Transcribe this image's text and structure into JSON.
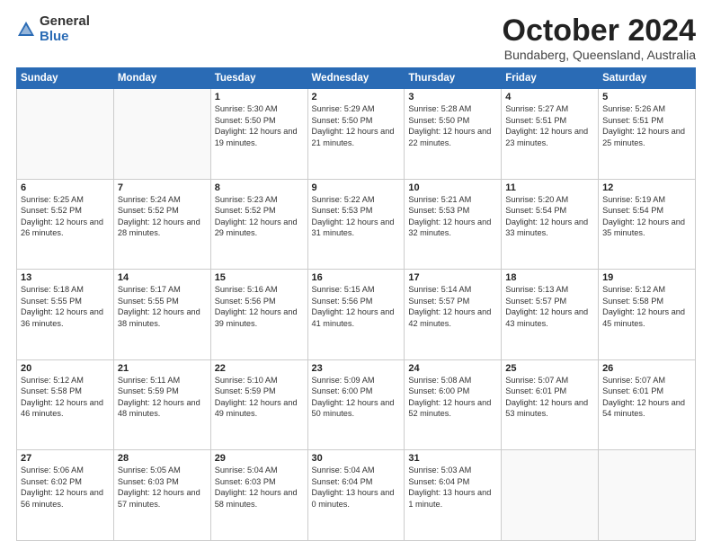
{
  "logo": {
    "general": "General",
    "blue": "Blue"
  },
  "title": {
    "month_year": "October 2024",
    "location": "Bundaberg, Queensland, Australia"
  },
  "days_of_week": [
    "Sunday",
    "Monday",
    "Tuesday",
    "Wednesday",
    "Thursday",
    "Friday",
    "Saturday"
  ],
  "weeks": [
    [
      {
        "day": "",
        "sunrise": "",
        "sunset": "",
        "daylight": ""
      },
      {
        "day": "",
        "sunrise": "",
        "sunset": "",
        "daylight": ""
      },
      {
        "day": "1",
        "sunrise": "Sunrise: 5:30 AM",
        "sunset": "Sunset: 5:50 PM",
        "daylight": "Daylight: 12 hours and 19 minutes."
      },
      {
        "day": "2",
        "sunrise": "Sunrise: 5:29 AM",
        "sunset": "Sunset: 5:50 PM",
        "daylight": "Daylight: 12 hours and 21 minutes."
      },
      {
        "day": "3",
        "sunrise": "Sunrise: 5:28 AM",
        "sunset": "Sunset: 5:50 PM",
        "daylight": "Daylight: 12 hours and 22 minutes."
      },
      {
        "day": "4",
        "sunrise": "Sunrise: 5:27 AM",
        "sunset": "Sunset: 5:51 PM",
        "daylight": "Daylight: 12 hours and 23 minutes."
      },
      {
        "day": "5",
        "sunrise": "Sunrise: 5:26 AM",
        "sunset": "Sunset: 5:51 PM",
        "daylight": "Daylight: 12 hours and 25 minutes."
      }
    ],
    [
      {
        "day": "6",
        "sunrise": "Sunrise: 5:25 AM",
        "sunset": "Sunset: 5:52 PM",
        "daylight": "Daylight: 12 hours and 26 minutes."
      },
      {
        "day": "7",
        "sunrise": "Sunrise: 5:24 AM",
        "sunset": "Sunset: 5:52 PM",
        "daylight": "Daylight: 12 hours and 28 minutes."
      },
      {
        "day": "8",
        "sunrise": "Sunrise: 5:23 AM",
        "sunset": "Sunset: 5:52 PM",
        "daylight": "Daylight: 12 hours and 29 minutes."
      },
      {
        "day": "9",
        "sunrise": "Sunrise: 5:22 AM",
        "sunset": "Sunset: 5:53 PM",
        "daylight": "Daylight: 12 hours and 31 minutes."
      },
      {
        "day": "10",
        "sunrise": "Sunrise: 5:21 AM",
        "sunset": "Sunset: 5:53 PM",
        "daylight": "Daylight: 12 hours and 32 minutes."
      },
      {
        "day": "11",
        "sunrise": "Sunrise: 5:20 AM",
        "sunset": "Sunset: 5:54 PM",
        "daylight": "Daylight: 12 hours and 33 minutes."
      },
      {
        "day": "12",
        "sunrise": "Sunrise: 5:19 AM",
        "sunset": "Sunset: 5:54 PM",
        "daylight": "Daylight: 12 hours and 35 minutes."
      }
    ],
    [
      {
        "day": "13",
        "sunrise": "Sunrise: 5:18 AM",
        "sunset": "Sunset: 5:55 PM",
        "daylight": "Daylight: 12 hours and 36 minutes."
      },
      {
        "day": "14",
        "sunrise": "Sunrise: 5:17 AM",
        "sunset": "Sunset: 5:55 PM",
        "daylight": "Daylight: 12 hours and 38 minutes."
      },
      {
        "day": "15",
        "sunrise": "Sunrise: 5:16 AM",
        "sunset": "Sunset: 5:56 PM",
        "daylight": "Daylight: 12 hours and 39 minutes."
      },
      {
        "day": "16",
        "sunrise": "Sunrise: 5:15 AM",
        "sunset": "Sunset: 5:56 PM",
        "daylight": "Daylight: 12 hours and 41 minutes."
      },
      {
        "day": "17",
        "sunrise": "Sunrise: 5:14 AM",
        "sunset": "Sunset: 5:57 PM",
        "daylight": "Daylight: 12 hours and 42 minutes."
      },
      {
        "day": "18",
        "sunrise": "Sunrise: 5:13 AM",
        "sunset": "Sunset: 5:57 PM",
        "daylight": "Daylight: 12 hours and 43 minutes."
      },
      {
        "day": "19",
        "sunrise": "Sunrise: 5:12 AM",
        "sunset": "Sunset: 5:58 PM",
        "daylight": "Daylight: 12 hours and 45 minutes."
      }
    ],
    [
      {
        "day": "20",
        "sunrise": "Sunrise: 5:12 AM",
        "sunset": "Sunset: 5:58 PM",
        "daylight": "Daylight: 12 hours and 46 minutes."
      },
      {
        "day": "21",
        "sunrise": "Sunrise: 5:11 AM",
        "sunset": "Sunset: 5:59 PM",
        "daylight": "Daylight: 12 hours and 48 minutes."
      },
      {
        "day": "22",
        "sunrise": "Sunrise: 5:10 AM",
        "sunset": "Sunset: 5:59 PM",
        "daylight": "Daylight: 12 hours and 49 minutes."
      },
      {
        "day": "23",
        "sunrise": "Sunrise: 5:09 AM",
        "sunset": "Sunset: 6:00 PM",
        "daylight": "Daylight: 12 hours and 50 minutes."
      },
      {
        "day": "24",
        "sunrise": "Sunrise: 5:08 AM",
        "sunset": "Sunset: 6:00 PM",
        "daylight": "Daylight: 12 hours and 52 minutes."
      },
      {
        "day": "25",
        "sunrise": "Sunrise: 5:07 AM",
        "sunset": "Sunset: 6:01 PM",
        "daylight": "Daylight: 12 hours and 53 minutes."
      },
      {
        "day": "26",
        "sunrise": "Sunrise: 5:07 AM",
        "sunset": "Sunset: 6:01 PM",
        "daylight": "Daylight: 12 hours and 54 minutes."
      }
    ],
    [
      {
        "day": "27",
        "sunrise": "Sunrise: 5:06 AM",
        "sunset": "Sunset: 6:02 PM",
        "daylight": "Daylight: 12 hours and 56 minutes."
      },
      {
        "day": "28",
        "sunrise": "Sunrise: 5:05 AM",
        "sunset": "Sunset: 6:03 PM",
        "daylight": "Daylight: 12 hours and 57 minutes."
      },
      {
        "day": "29",
        "sunrise": "Sunrise: 5:04 AM",
        "sunset": "Sunset: 6:03 PM",
        "daylight": "Daylight: 12 hours and 58 minutes."
      },
      {
        "day": "30",
        "sunrise": "Sunrise: 5:04 AM",
        "sunset": "Sunset: 6:04 PM",
        "daylight": "Daylight: 13 hours and 0 minutes."
      },
      {
        "day": "31",
        "sunrise": "Sunrise: 5:03 AM",
        "sunset": "Sunset: 6:04 PM",
        "daylight": "Daylight: 13 hours and 1 minute."
      },
      {
        "day": "",
        "sunrise": "",
        "sunset": "",
        "daylight": ""
      },
      {
        "day": "",
        "sunrise": "",
        "sunset": "",
        "daylight": ""
      }
    ]
  ]
}
